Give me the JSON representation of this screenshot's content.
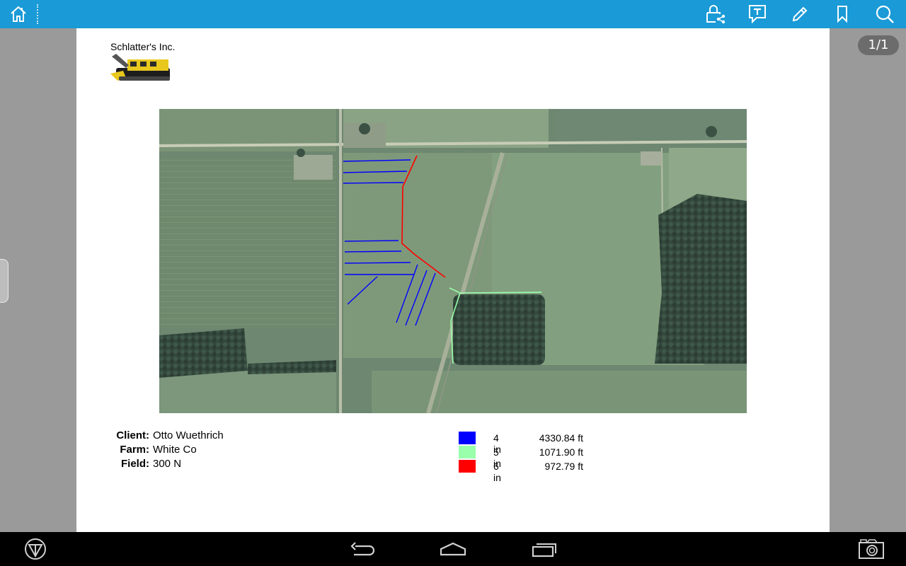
{
  "toolbar": {
    "icons": [
      "home-icon",
      "share-icon",
      "text-icon",
      "pen-icon",
      "bookmark-icon",
      "search-icon"
    ],
    "accent": "#1a9ad6"
  },
  "page_indicator": "1/1",
  "document": {
    "company_name": "Schlatter's Inc.",
    "client_label": "Client:",
    "client_value": "Otto Wuethrich",
    "farm_label": "Farm:",
    "farm_value": "White Co",
    "field_label": "Field:",
    "field_value": "300 N",
    "legend": [
      {
        "color": "#0000ff",
        "size": "4 in",
        "length": "4330.84 ft"
      },
      {
        "color": "#99ffaa",
        "size": "5 in",
        "length": "1071.90 ft"
      },
      {
        "color": "#ff0000",
        "size": "6 in",
        "length": "972.79 ft"
      }
    ]
  },
  "system_nav": {
    "icons": [
      "app-logo-icon",
      "back-icon",
      "home-icon",
      "recent-apps-icon",
      "screenshot-icon"
    ]
  }
}
